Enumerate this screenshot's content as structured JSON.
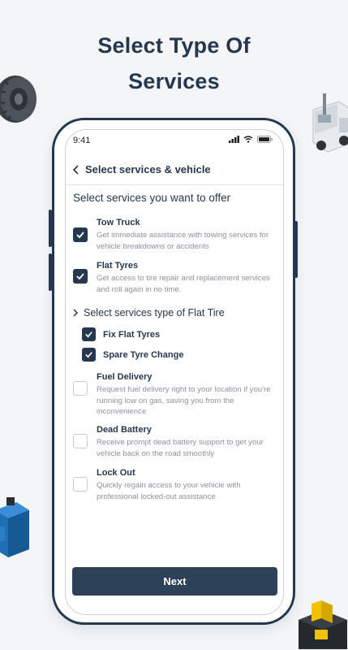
{
  "promo": {
    "title_line1": "Select Type Of",
    "title_line2": "Services"
  },
  "status_bar": {
    "time": "9:41"
  },
  "header": {
    "title": "Select services & vehicle"
  },
  "section_title": "Select services you want to offer",
  "services": [
    {
      "name": "Tow Truck",
      "description": "Get immediate assistance with towing services for vehicle breakdowns or accidents",
      "checked": true
    },
    {
      "name": "Flat Tyres",
      "description": "Get access to tire repair and replacement services and roll again in no time.",
      "checked": true
    },
    {
      "name": "Fuel Delivery",
      "description": "Request fuel delivery right to your location if you're running low on gas, saving you from the inconvenience",
      "checked": false
    },
    {
      "name": "Dead Battery",
      "description": "Receive prompt dead battery support to get your vehicle back on the road smoothly",
      "checked": false
    },
    {
      "name": "Lock Out",
      "description": "Quickly regain access to your vehicle with professional locked-out assistance",
      "checked": false
    }
  ],
  "subsection": {
    "title": "Select services type of Flat Tire",
    "items": [
      {
        "label": "Fix Flat Tyres",
        "checked": true
      },
      {
        "label": "Spare Tyre Change",
        "checked": true
      }
    ]
  },
  "next_label": "Next",
  "colors": {
    "primary": "#26384f",
    "button": "#2d4258",
    "muted_text": "#8a939c",
    "background": "#f3f5f7"
  },
  "icons": [
    "tire-illustration",
    "tow-truck-illustration",
    "jerrycan-illustration",
    "battery-illustration",
    "back-chevron-icon",
    "chevron-right-icon",
    "check-icon",
    "signal-icon",
    "wifi-icon",
    "battery-icon"
  ]
}
